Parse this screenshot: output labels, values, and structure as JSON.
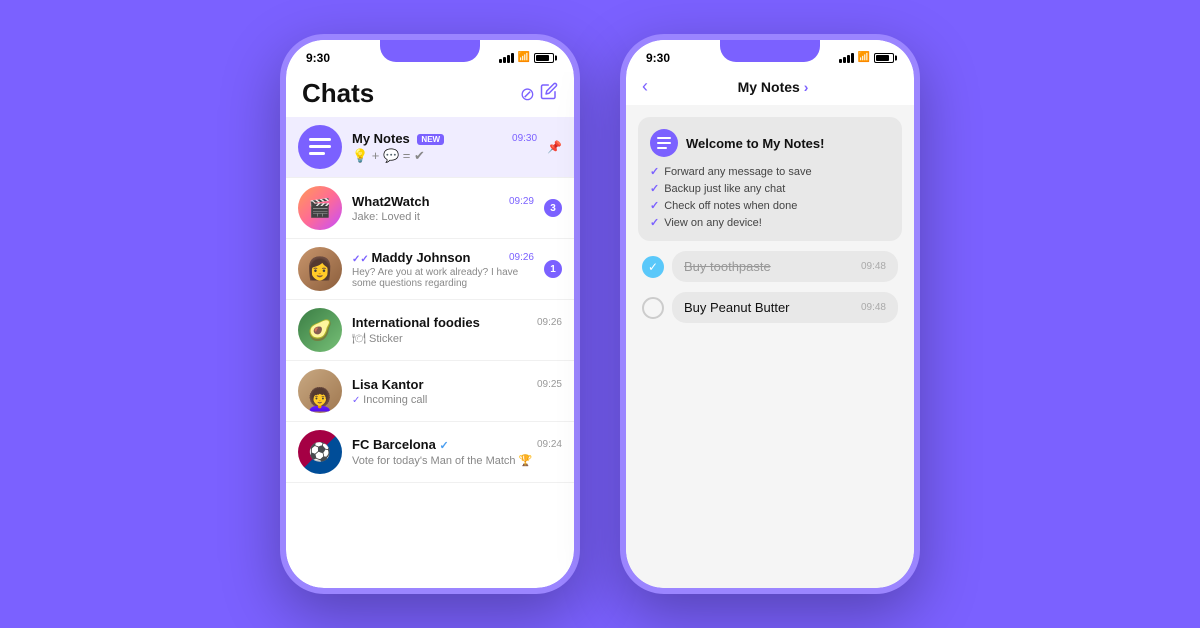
{
  "background_color": "#7B61FF",
  "phone1": {
    "status_bar": {
      "time": "9:30"
    },
    "header": {
      "title": "Chats",
      "compose_icon": "✏️"
    },
    "chats": [
      {
        "id": "mynotes",
        "name": "My Notes",
        "badge": "NEW",
        "time": "09:30",
        "preview": "💡 + 💬 = ✔",
        "avatar_type": "mynotes",
        "avatar_icon": "☰",
        "unread": null,
        "pinned": true,
        "active": true
      },
      {
        "id": "what2watch",
        "name": "What2Watch",
        "time": "09:29",
        "preview": "Jake: Loved it",
        "avatar_type": "w2w",
        "avatar_icon": "🎬",
        "unread": "3",
        "active": false
      },
      {
        "id": "maddy",
        "name": "Maddy Johnson",
        "time": "09:26",
        "preview": "Hey? Are you at work already? I have some questions regarding",
        "avatar_type": "maddy",
        "avatar_icon": "👩",
        "unread": "1",
        "double_check": true,
        "active": false
      },
      {
        "id": "intl",
        "name": "International foodies",
        "time": "09:26",
        "preview": "🍽 Sticker",
        "avatar_type": "intl",
        "avatar_icon": "🥑",
        "unread": null,
        "active": false
      },
      {
        "id": "lisa",
        "name": "Lisa Kantor",
        "time": "09:25",
        "preview": "Incoming call",
        "avatar_type": "lisa",
        "avatar_icon": "👩‍🦱",
        "unread": null,
        "double_check": true,
        "active": false
      },
      {
        "id": "fcb",
        "name": "FC Barcelona",
        "time": "09:24",
        "preview": "Vote for today's Man of the Match 🏆",
        "avatar_type": "fcb",
        "avatar_icon": "⚽",
        "verified": true,
        "unread": null,
        "active": false
      }
    ]
  },
  "phone2": {
    "status_bar": {
      "time": "9:30"
    },
    "header": {
      "back_label": "‹",
      "title": "My Notes",
      "chevron": "›"
    },
    "welcome_card": {
      "title": "Welcome to My Notes!",
      "items": [
        "Forward any message to save",
        "Backup just like any chat",
        "Check off notes when done",
        "View on any device!"
      ]
    },
    "todos": [
      {
        "text": "Buy toothpaste",
        "time": "09:48",
        "done": true
      },
      {
        "text": "Buy Peanut Butter",
        "time": "09:48",
        "done": false
      }
    ]
  }
}
